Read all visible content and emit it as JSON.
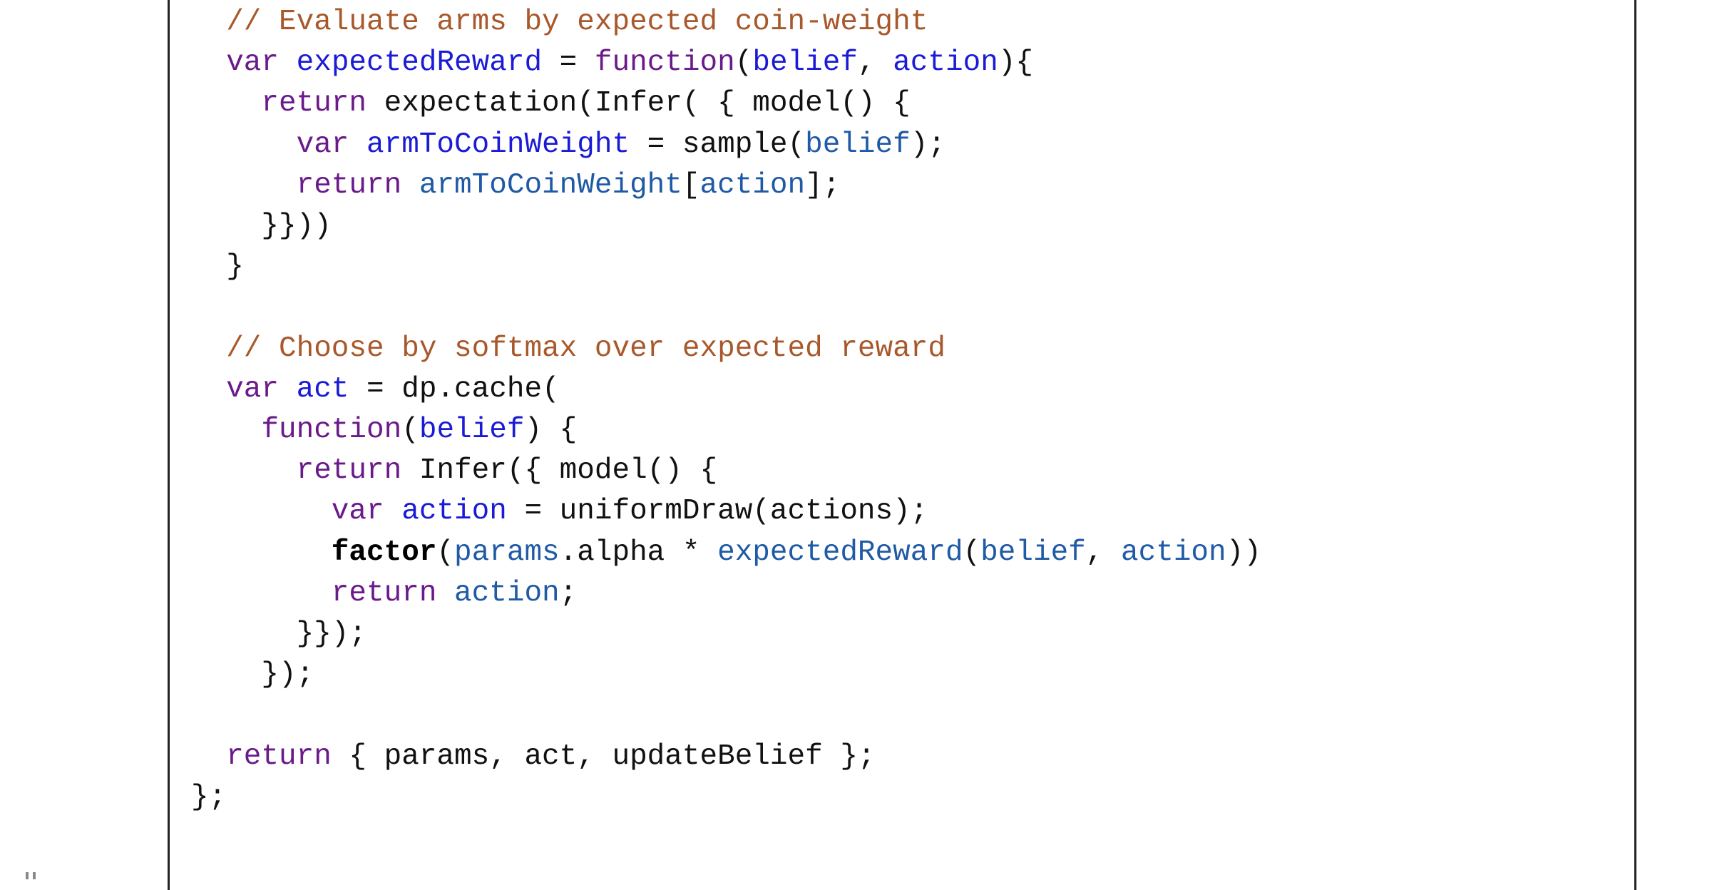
{
  "code": {
    "lines": [
      {
        "indent": 2,
        "tokens": [
          {
            "t": "// Evaluate arms by expected coin-weight",
            "k": "com"
          }
        ]
      },
      {
        "indent": 2,
        "tokens": [
          {
            "t": "var",
            "k": "kw"
          },
          {
            "t": " ",
            "k": "plain"
          },
          {
            "t": "expectedReward",
            "k": "def"
          },
          {
            "t": " = ",
            "k": "plain"
          },
          {
            "t": "function",
            "k": "kw"
          },
          {
            "t": "(",
            "k": "plain"
          },
          {
            "t": "belief",
            "k": "def"
          },
          {
            "t": ", ",
            "k": "plain"
          },
          {
            "t": "action",
            "k": "def"
          },
          {
            "t": "){",
            "k": "plain"
          }
        ]
      },
      {
        "indent": 4,
        "tokens": [
          {
            "t": "return",
            "k": "kw"
          },
          {
            "t": " expectation(Infer( { model() {",
            "k": "plain"
          }
        ]
      },
      {
        "indent": 6,
        "tokens": [
          {
            "t": "var",
            "k": "kw"
          },
          {
            "t": " ",
            "k": "plain"
          },
          {
            "t": "armToCoinWeight",
            "k": "def"
          },
          {
            "t": " = sample(",
            "k": "plain"
          },
          {
            "t": "belief",
            "k": "var"
          },
          {
            "t": ");",
            "k": "plain"
          }
        ]
      },
      {
        "indent": 6,
        "tokens": [
          {
            "t": "return",
            "k": "kw"
          },
          {
            "t": " ",
            "k": "plain"
          },
          {
            "t": "armToCoinWeight",
            "k": "var"
          },
          {
            "t": "[",
            "k": "plain"
          },
          {
            "t": "action",
            "k": "var"
          },
          {
            "t": "];",
            "k": "plain"
          }
        ]
      },
      {
        "indent": 4,
        "tokens": [
          {
            "t": "}}))",
            "k": "plain"
          }
        ]
      },
      {
        "indent": 2,
        "tokens": [
          {
            "t": "}",
            "k": "plain"
          }
        ]
      },
      {
        "indent": 0,
        "tokens": []
      },
      {
        "indent": 2,
        "tokens": [
          {
            "t": "// Choose by softmax over expected reward",
            "k": "com"
          }
        ]
      },
      {
        "indent": 2,
        "tokens": [
          {
            "t": "var",
            "k": "kw"
          },
          {
            "t": " ",
            "k": "plain"
          },
          {
            "t": "act",
            "k": "def"
          },
          {
            "t": " = dp.cache(",
            "k": "plain"
          }
        ]
      },
      {
        "indent": 4,
        "tokens": [
          {
            "t": "function",
            "k": "kw"
          },
          {
            "t": "(",
            "k": "plain"
          },
          {
            "t": "belief",
            "k": "def"
          },
          {
            "t": ") {",
            "k": "plain"
          }
        ]
      },
      {
        "indent": 6,
        "tokens": [
          {
            "t": "return",
            "k": "kw"
          },
          {
            "t": " Infer({ model() {",
            "k": "plain"
          }
        ]
      },
      {
        "indent": 8,
        "tokens": [
          {
            "t": "var",
            "k": "kw"
          },
          {
            "t": " ",
            "k": "plain"
          },
          {
            "t": "action",
            "k": "def"
          },
          {
            "t": " = uniformDraw(actions);",
            "k": "plain"
          }
        ]
      },
      {
        "indent": 8,
        "tokens": [
          {
            "t": "factor",
            "k": "bold"
          },
          {
            "t": "(",
            "k": "plain"
          },
          {
            "t": "params",
            "k": "var"
          },
          {
            "t": ".alpha * ",
            "k": "plain"
          },
          {
            "t": "expectedReward",
            "k": "var"
          },
          {
            "t": "(",
            "k": "plain"
          },
          {
            "t": "belief",
            "k": "var"
          },
          {
            "t": ", ",
            "k": "plain"
          },
          {
            "t": "action",
            "k": "var"
          },
          {
            "t": "))",
            "k": "plain"
          }
        ]
      },
      {
        "indent": 8,
        "tokens": [
          {
            "t": "return",
            "k": "kw"
          },
          {
            "t": " ",
            "k": "plain"
          },
          {
            "t": "action",
            "k": "var"
          },
          {
            "t": ";",
            "k": "plain"
          }
        ]
      },
      {
        "indent": 6,
        "tokens": [
          {
            "t": "}});",
            "k": "plain"
          }
        ]
      },
      {
        "indent": 4,
        "tokens": [
          {
            "t": "});",
            "k": "plain"
          }
        ]
      },
      {
        "indent": 0,
        "tokens": []
      },
      {
        "indent": 2,
        "tokens": [
          {
            "t": "return",
            "k": "kw"
          },
          {
            "t": " { params, act, updateBelief };",
            "k": "plain"
          }
        ]
      },
      {
        "indent": 0,
        "tokens": [
          {
            "t": "};",
            "k": "plain"
          }
        ]
      }
    ]
  },
  "colors": {
    "keyword": "#6a1a8a",
    "definition": "#1b1bd6",
    "variable": "#1f5aa6",
    "comment": "#a8582a",
    "text": "#111111",
    "frame": "#222222",
    "background": "#ffffff"
  }
}
